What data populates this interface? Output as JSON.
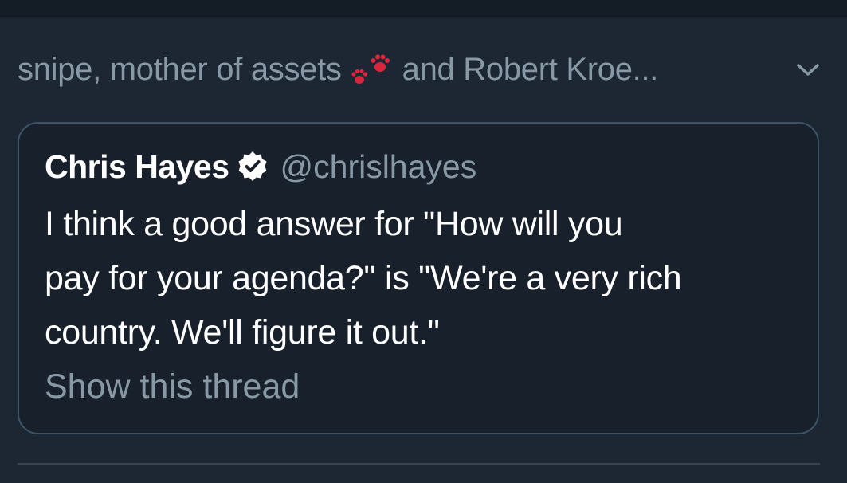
{
  "social_context": {
    "text_before": "snipe, mother of assets",
    "emoji_icon": "paw-prints-icon",
    "text_after": "and Robert Kroe..."
  },
  "menu_icon": "chevron-down-icon",
  "quoted_tweet": {
    "author_name": "Chris Hayes",
    "verified_icon": "verified-badge-icon",
    "handle": "@chrislhayes",
    "text_lines": [
      "I think a good answer for \"How will you",
      "pay for your agenda?\" is \"We're a very rich",
      "country. We'll figure it out.\""
    ],
    "show_thread": "Show this thread"
  },
  "colors": {
    "background": "#1c2733",
    "card_background": "#18212b",
    "card_border": "#3d5466",
    "secondary_text": "#8899a6",
    "primary_text": "#ffffff",
    "paw_color": "#e0245e"
  }
}
